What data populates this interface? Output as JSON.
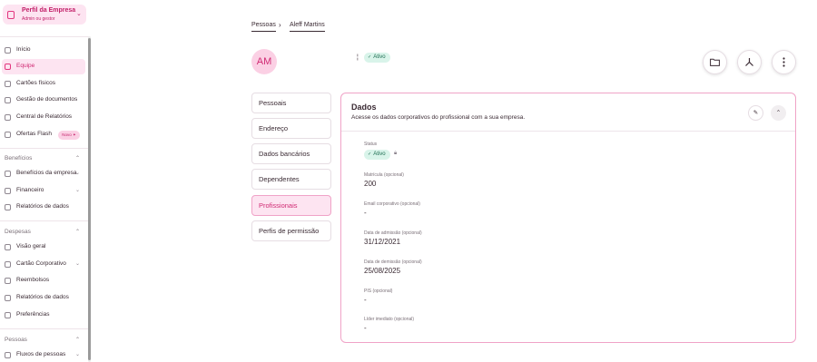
{
  "company": {
    "title": "Perfil da Empresa",
    "subtitle": "Admin ou gestor"
  },
  "nav": {
    "top": [
      {
        "label": "Início"
      },
      {
        "label": "Equipe"
      },
      {
        "label": "Cartões físicos"
      },
      {
        "label": "Gestão de documentos"
      },
      {
        "label": "Central de Relatórios"
      },
      {
        "label": "Ofertas Flash",
        "badge": "Novo ✦"
      }
    ],
    "beneficios": {
      "label": "Benefícios",
      "items": [
        {
          "label": "Benefícios da empresa"
        },
        {
          "label": "Financeiro"
        },
        {
          "label": "Relatórios de dados"
        }
      ]
    },
    "despesas": {
      "label": "Despesas",
      "items": [
        {
          "label": "Visão geral"
        },
        {
          "label": "Cartão Corporativo"
        },
        {
          "label": "Reembolsos"
        },
        {
          "label": "Relatórios de dados"
        },
        {
          "label": "Preferências"
        }
      ]
    },
    "pessoas": {
      "label": "Pessoas",
      "items": [
        {
          "label": "Fluxos de pessoas"
        }
      ]
    }
  },
  "breadcrumb": {
    "parent": "Pessoas",
    "current": "Aleff Martins"
  },
  "profile": {
    "initials": "AM",
    "name": "¦",
    "status": "Ativo"
  },
  "tabs": [
    {
      "label": "Pessoais"
    },
    {
      "label": "Endereço"
    },
    {
      "label": "Dados bancários"
    },
    {
      "label": "Dependentes"
    },
    {
      "label": "Profissionais"
    },
    {
      "label": "Perfis de permissão"
    }
  ],
  "card": {
    "title": "Dados",
    "subtitle": "Acesse os dados corporativos do profissional com a sua empresa.",
    "fields": [
      {
        "label": "Status",
        "value": "Ativo"
      },
      {
        "label": "Matrícula (opcional)",
        "value": "200"
      },
      {
        "label": "Email corporativo (opcional)",
        "value": "-"
      },
      {
        "label": "Data de admissão (opcional)",
        "value": "31/12/2021"
      },
      {
        "label": "Data de demissão (opcional)",
        "value": "25/08/2025"
      },
      {
        "label": "PIS (opcional)",
        "value": "-"
      },
      {
        "label": "Líder imediato (opcional)",
        "value": "-"
      }
    ]
  },
  "colors": {
    "accent": "#e2367e",
    "accent_bg": "#fde4f1",
    "status_bg": "#d9f4ea",
    "status_text": "#1d6e52"
  }
}
